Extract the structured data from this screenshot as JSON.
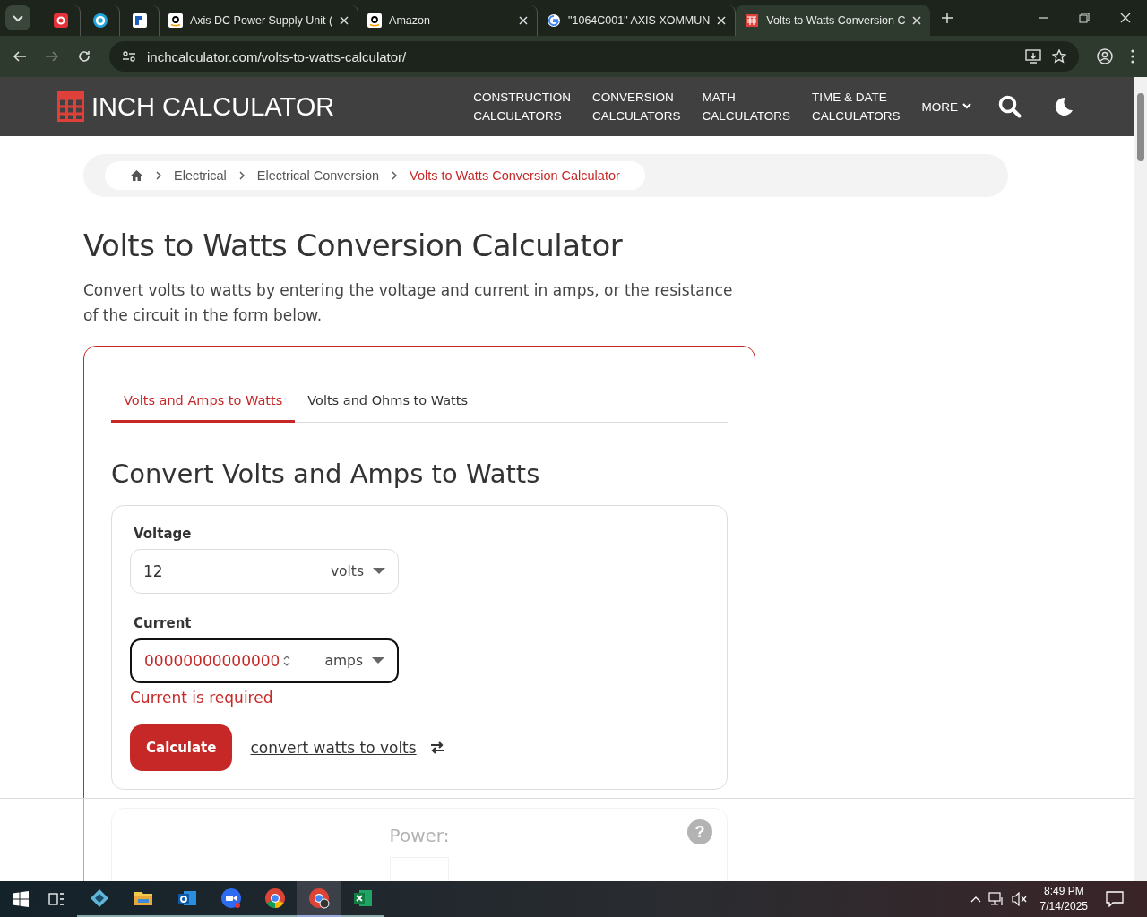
{
  "browser": {
    "tabs": [
      {
        "selected": false
      },
      {
        "selected": false
      },
      {
        "selected": false
      },
      {
        "title": "Axis DC Power Supply Unit (",
        "selected": false
      },
      {
        "title": "Amazon",
        "selected": false
      },
      {
        "title": "\"1064C001\" AXIS XOMMUN",
        "selected": false
      },
      {
        "title": "Volts to Watts Conversion C",
        "selected": true
      }
    ],
    "address": "inchcalculator.com/volts-to-watts-calculator/"
  },
  "site": {
    "logo": "INCH CALCULATOR",
    "nav": [
      [
        "CONSTRUCTION",
        "CALCULATORS"
      ],
      [
        "CONVERSION",
        "CALCULATORS"
      ],
      [
        "MATH",
        "CALCULATORS"
      ],
      [
        "TIME & DATE",
        "CALCULATORS"
      ]
    ],
    "more": "MORE"
  },
  "breadcrumb": [
    {
      "label": "Electrical",
      "current": false
    },
    {
      "label": "Electrical Conversion",
      "current": false
    },
    {
      "label": "Volts to Watts Conversion Calculator",
      "current": true
    }
  ],
  "title": "Volts to Watts Conversion Calculator",
  "intro": "Convert volts to watts by entering the voltage and current in amps, or the resistance of the circuit in the form below.",
  "calculator": {
    "tabs": [
      {
        "label": "Volts and Amps to Watts",
        "selected": true
      },
      {
        "label": "Volts and Ohms to Watts",
        "selected": false
      }
    ],
    "heading": "Convert Volts and Amps to Watts",
    "fields": [
      {
        "label": "Voltage",
        "value": "12",
        "unit": "volts",
        "focused": false,
        "invalid": false
      },
      {
        "label": "Current",
        "value": "00000000000000",
        "unit": "amps",
        "focused": true,
        "invalid": true,
        "error": "Current is required"
      }
    ],
    "button": "Calculate",
    "link": "convert watts to volts"
  },
  "result": {
    "label": "Power:",
    "help": "?"
  },
  "taskbar": {
    "apps": [
      {
        "active": false
      },
      {
        "active": false
      },
      {
        "active": false
      },
      {
        "active": false
      },
      {
        "active": false
      },
      {
        "active": true
      },
      {
        "active": false
      }
    ],
    "time": "8:49 PM",
    "date": "7/14/2025"
  }
}
